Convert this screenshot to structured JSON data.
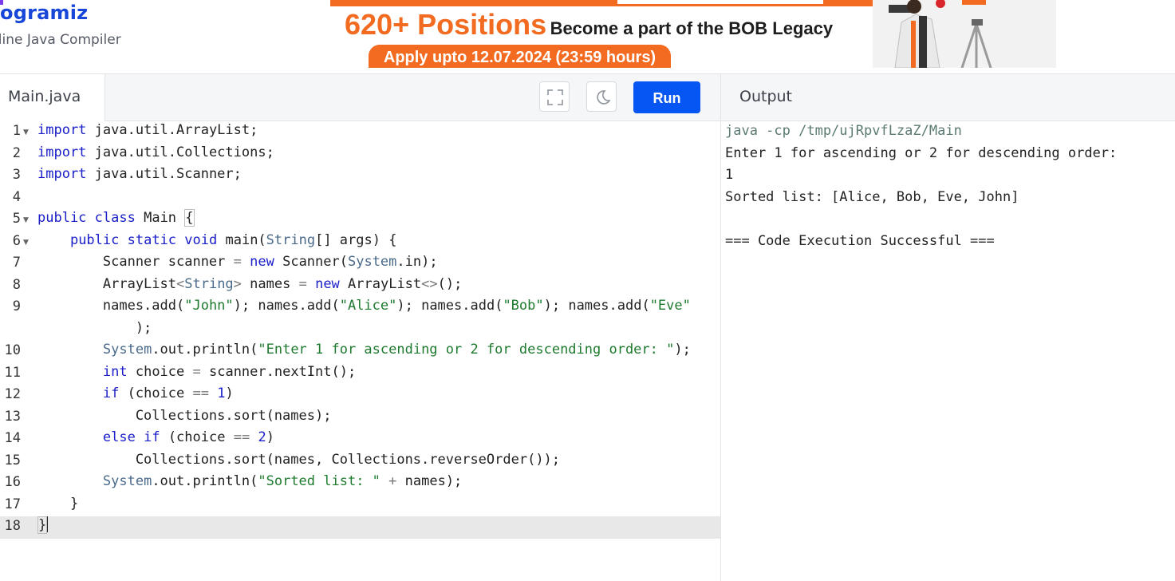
{
  "header": {
    "logo": "rogramiz",
    "subtitle": "nline Java Compiler"
  },
  "ad": {
    "headline_big": "620+ Positions",
    "headline_mid": "Become a part of the BOB Legacy",
    "pill": "Apply upto 12.07.2024 (23:59 hours)"
  },
  "editor": {
    "file_tab": "Main.java",
    "fullscreen_icon": "fullscreen-icon",
    "theme_icon": "moon-icon",
    "run_label": "Run",
    "lines": [
      {
        "n": "1",
        "fold": true
      },
      {
        "n": "2"
      },
      {
        "n": "3"
      },
      {
        "n": "4"
      },
      {
        "n": "5",
        "fold": true
      },
      {
        "n": "6",
        "fold": true
      },
      {
        "n": "7"
      },
      {
        "n": "8"
      },
      {
        "n": "9"
      },
      {
        "n": "10"
      },
      {
        "n": "11"
      },
      {
        "n": "12"
      },
      {
        "n": "13"
      },
      {
        "n": "14"
      },
      {
        "n": "15"
      },
      {
        "n": "16"
      },
      {
        "n": "17"
      },
      {
        "n": "18"
      }
    ]
  },
  "output": {
    "title": "Output",
    "lines": [
      "java -cp /tmp/ujRpvfLzaZ/Main",
      "Enter 1 for ascending or 2 for descending order:",
      "1",
      "Sorted list: [Alice, Bob, Eve, John]",
      "",
      "=== Code Execution Successful ==="
    ]
  }
}
